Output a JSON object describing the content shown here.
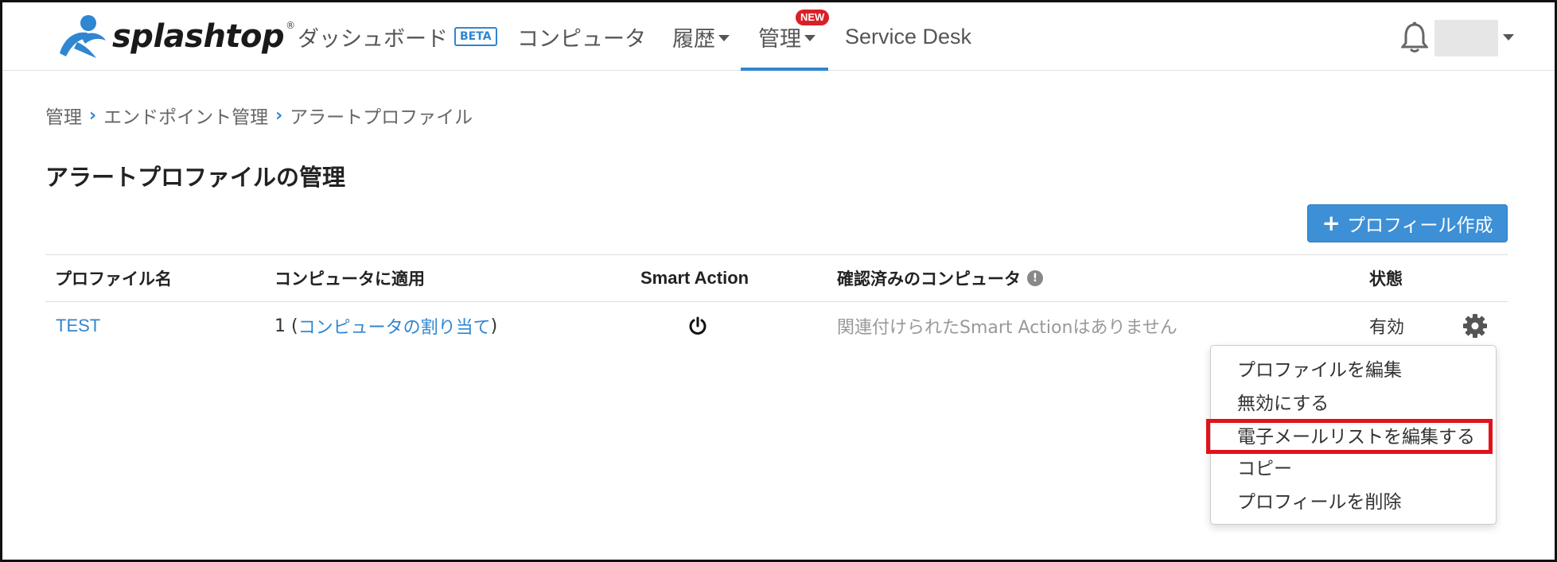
{
  "app": {
    "logo_text": "splashtop",
    "logo_reg": "®"
  },
  "nav": {
    "dashboard": "ダッシュボード",
    "dashboard_badge": "BETA",
    "computers": "コンピュータ",
    "history": "履歴",
    "admin": "管理",
    "admin_badge": "NEW",
    "service_desk": "Service Desk"
  },
  "breadcrumb": {
    "items": [
      "管理",
      "エンドポイント管理",
      "アラートプロファイル"
    ],
    "separator": "›"
  },
  "page": {
    "title": "アラートプロファイルの管理",
    "create_button": "プロフィール作成",
    "create_button_icon": "+"
  },
  "table": {
    "headers": {
      "profile_name": "プロファイル名",
      "apply": "コンピュータに適用",
      "smart_action": "Smart Action",
      "confirmed": "確認済みのコンピュータ",
      "status": "状態"
    },
    "info_icon_glyph": "!",
    "rows": [
      {
        "name": "TEST",
        "apply_count": "1 (",
        "apply_link": "コンピュータの割り当て",
        "apply_close": ")",
        "confirmed": "関連付けられたSmart Actionはありません",
        "status": "有効"
      }
    ]
  },
  "menu": {
    "items": [
      "プロファイルを編集",
      "無効にする",
      "電子メールリストを編集する",
      "コピー",
      "プロフィールを削除"
    ]
  },
  "colors": {
    "accent": "#2f86d1",
    "badge_red": "#d92028",
    "highlight": "#e1121a"
  }
}
